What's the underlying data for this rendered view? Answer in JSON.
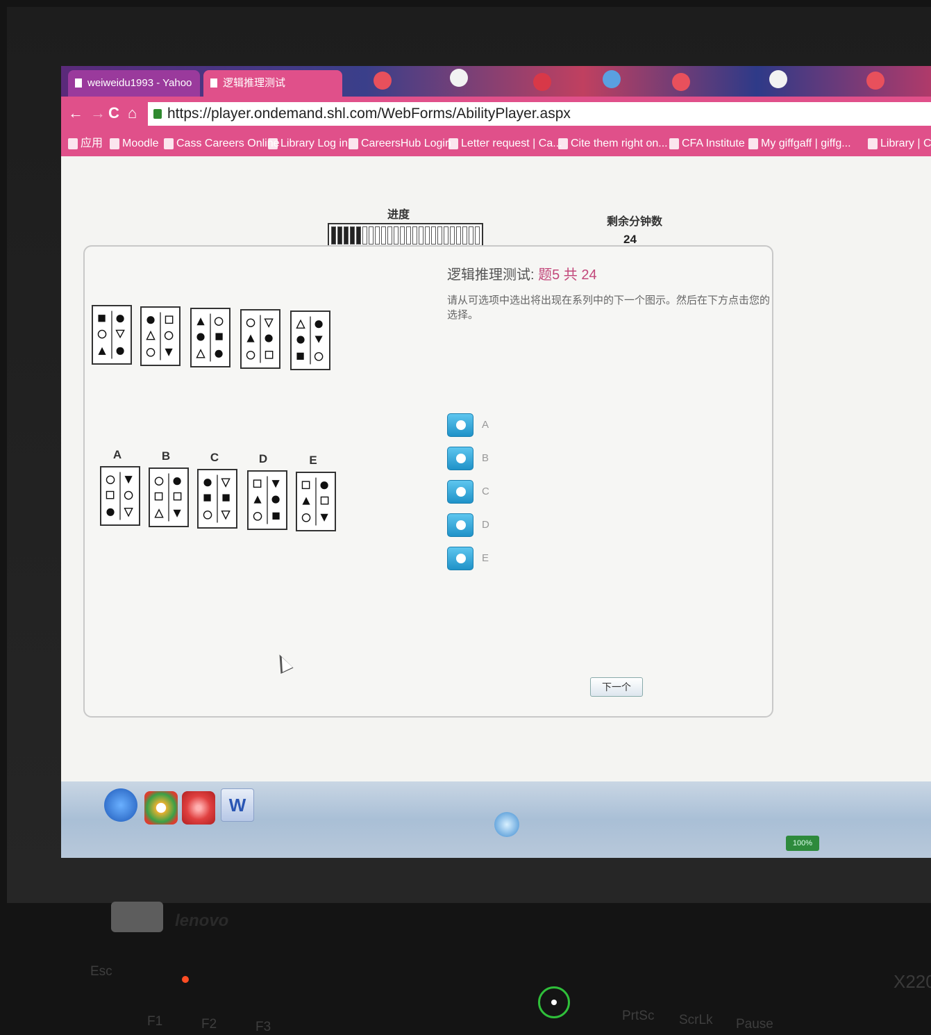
{
  "browser": {
    "tabs": [
      {
        "label": "weiweidu1993 - Yahoo"
      },
      {
        "label": "逻辑推理测试"
      }
    ],
    "url": "https://player.ondemand.shl.com/WebForms/AbilityPlayer.aspx",
    "bookmarks": [
      "应用",
      "Moodle",
      "Cass Careers Online",
      "Library Log in",
      "CareersHub Login",
      "Letter request | Ca...",
      "Cite them right on...",
      "CFA Institute",
      "My giffgaff | giffg...",
      "Library | Ci"
    ]
  },
  "test": {
    "progress_label": "进度",
    "progress_filled": 5,
    "progress_total": 24,
    "timer_label": "剩余分钟数",
    "timer_value": "24",
    "title_prefix": "逻辑推理测试:",
    "title_question": "题5 共 24",
    "instruction": "请从可选项中选出将出现在系列中的下一个图示。然后在下方点击您的选择。",
    "answer_labels": [
      "A",
      "B",
      "C",
      "D",
      "E"
    ],
    "options": [
      "A",
      "B",
      "C",
      "D",
      "E"
    ],
    "next_button": "下一个"
  },
  "taskbar": {
    "word_label": "W",
    "battery": "100%"
  },
  "keyboard": {
    "brand": "lenovo",
    "model": "X220",
    "keys": [
      "Esc",
      "F1",
      "F2",
      "F3",
      "PrtSc",
      "ScrLk",
      "Pause"
    ]
  },
  "colors": {
    "chrome_pink": "#e0508a",
    "question_accent": "#c2477a",
    "radio_blue": "#1f92c8",
    "power_led": "#2fbf3a"
  }
}
